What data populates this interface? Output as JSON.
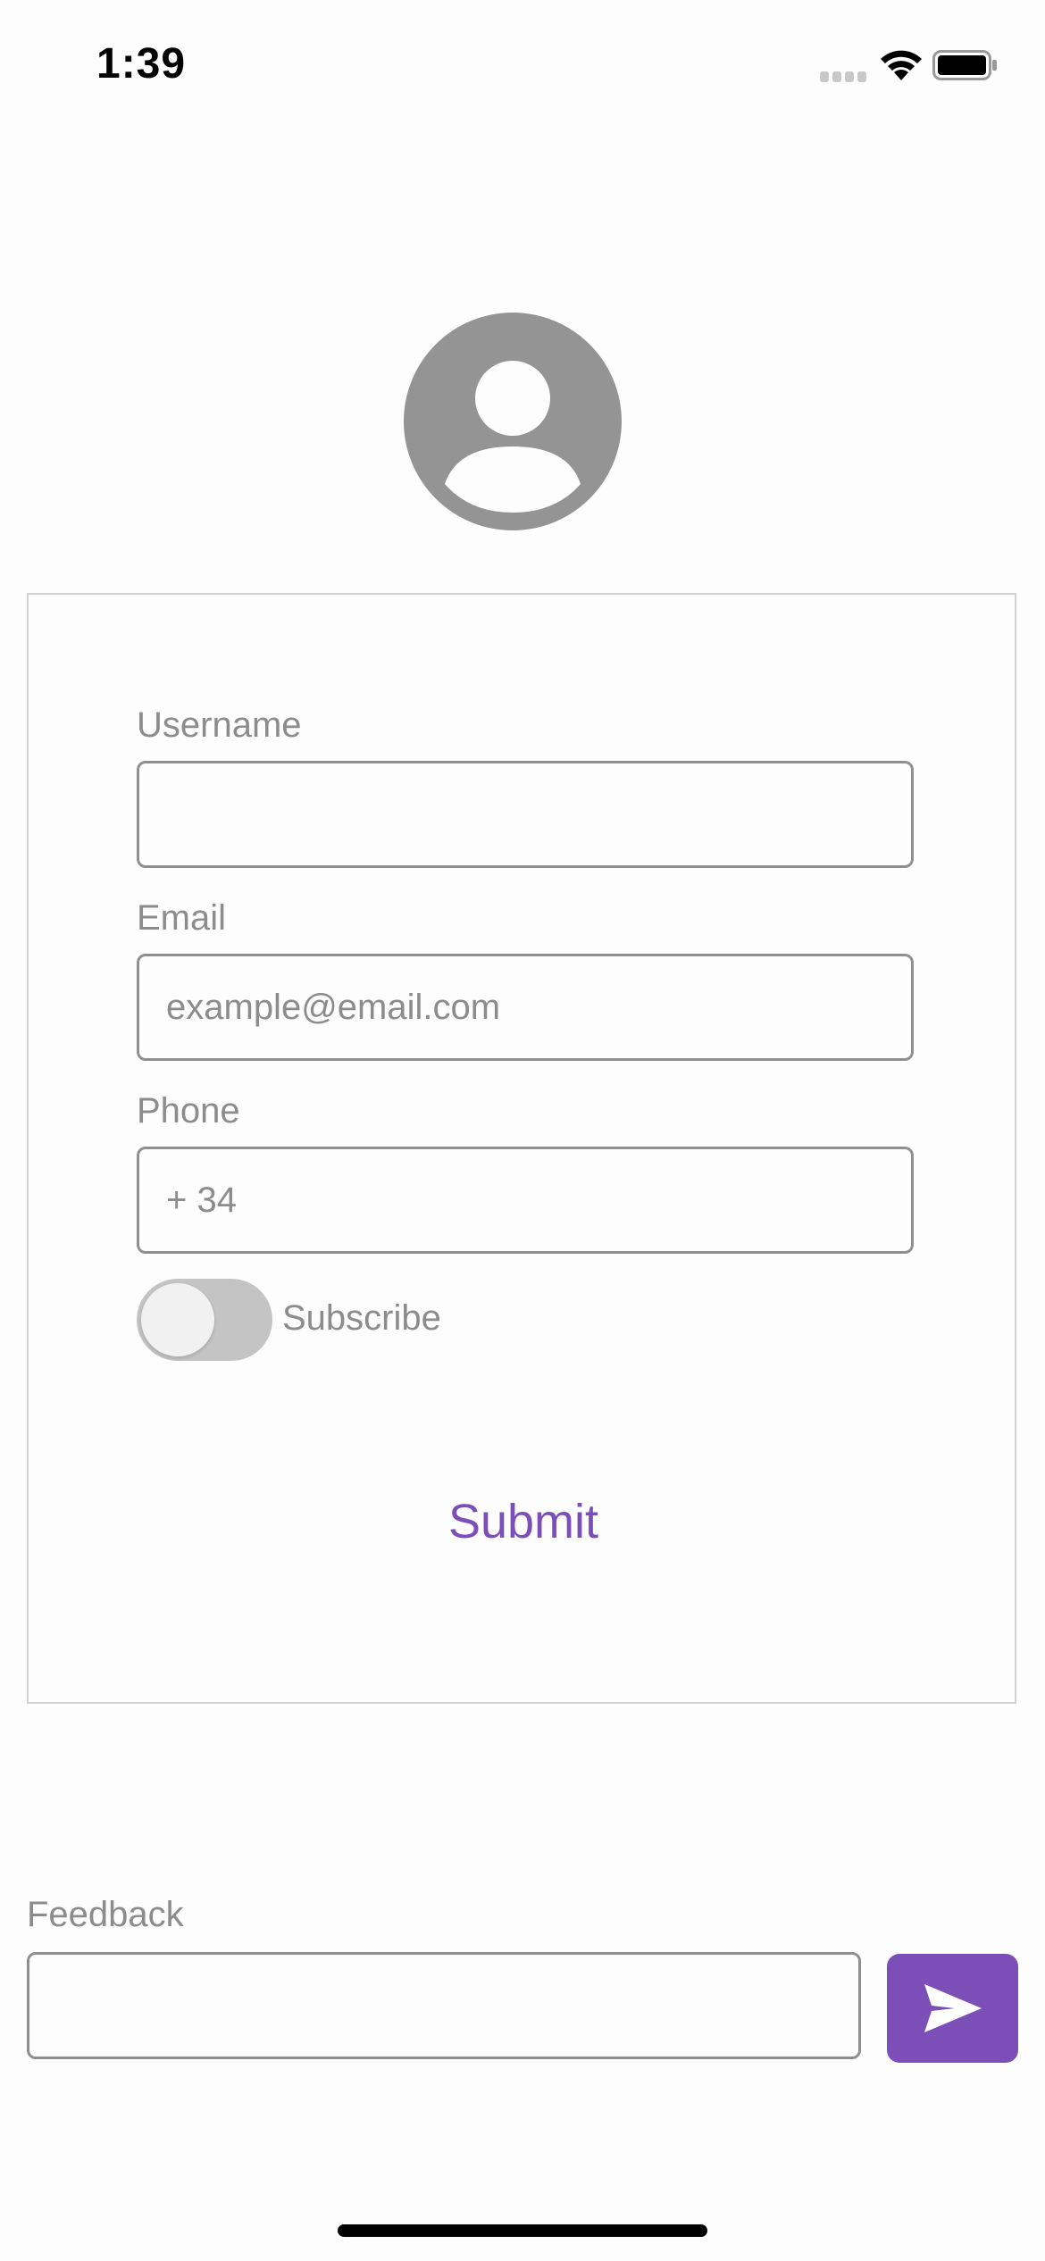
{
  "status_bar": {
    "time": "1:39",
    "icons": [
      "cellular-signal-icon",
      "wifi-icon",
      "battery-icon"
    ]
  },
  "profile": {
    "avatar_icon": "user-avatar-icon"
  },
  "form": {
    "username": {
      "label": "Username",
      "value": "",
      "placeholder": ""
    },
    "email": {
      "label": "Email",
      "value": "",
      "placeholder": "example@email.com"
    },
    "phone": {
      "label": "Phone",
      "value": "",
      "placeholder": "+ 34"
    },
    "subscribe": {
      "label": "Subscribe",
      "enabled": false
    },
    "submit_label": "Submit"
  },
  "feedback": {
    "label": "Feedback",
    "value": "",
    "send_icon": "send-icon"
  },
  "colors": {
    "accent": "#7b4fb7",
    "label_gray": "#8c8c8c",
    "avatar_gray": "#949494",
    "switch_off": "#c4c4c4"
  }
}
